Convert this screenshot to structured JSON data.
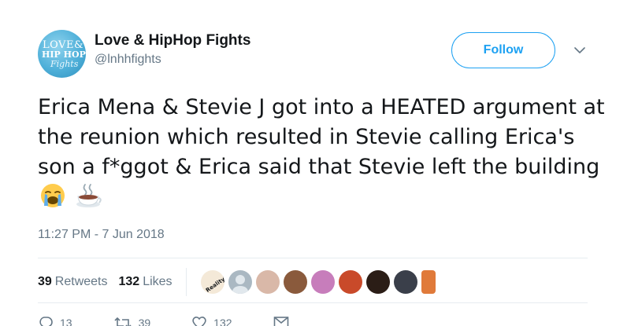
{
  "author": {
    "name": "Love & HipHop Fights",
    "handle": "@lnhhfights",
    "avatar_text": {
      "line1": "LOVE&",
      "line2": "HIP HOP",
      "line3": "Fights"
    }
  },
  "follow_label": "Follow",
  "tweet": {
    "text": "Erica Mena & Stevie J got into a HEATED argument at the reunion which resulted in Stevie calling Erica's son a f*ggot & Erica said that Stevie left the building",
    "emojis": [
      "loudly-crying-face-emoji",
      "hot-beverage-emoji"
    ]
  },
  "timestamp": "11:27 PM - 7 Jun 2018",
  "stats": {
    "retweets_count": "39",
    "retweets_label": "Retweets",
    "likes_count": "132",
    "likes_label": "Likes"
  },
  "likers": [
    {
      "name": "liker-1",
      "color": "#f4e9d8",
      "badge_text": "RealityTV"
    },
    {
      "name": "liker-2",
      "color": "#aab8c2"
    },
    {
      "name": "liker-3",
      "color": "#d9b8a8"
    },
    {
      "name": "liker-4",
      "color": "#8a5a3c"
    },
    {
      "name": "liker-5",
      "color": "#c77dbb"
    },
    {
      "name": "liker-6",
      "color": "#c94a2a"
    },
    {
      "name": "liker-7",
      "color": "#2b1d16"
    },
    {
      "name": "liker-8",
      "color": "#3a3f4a"
    },
    {
      "name": "liker-9",
      "color": "#e07a3a"
    }
  ],
  "actions": {
    "reply_count": "13",
    "retweet_count": "39",
    "like_count": "132"
  },
  "colors": {
    "accent": "#1da1f2",
    "text": "#14171a",
    "secondary": "#657786",
    "divider": "#e6ecf0"
  }
}
